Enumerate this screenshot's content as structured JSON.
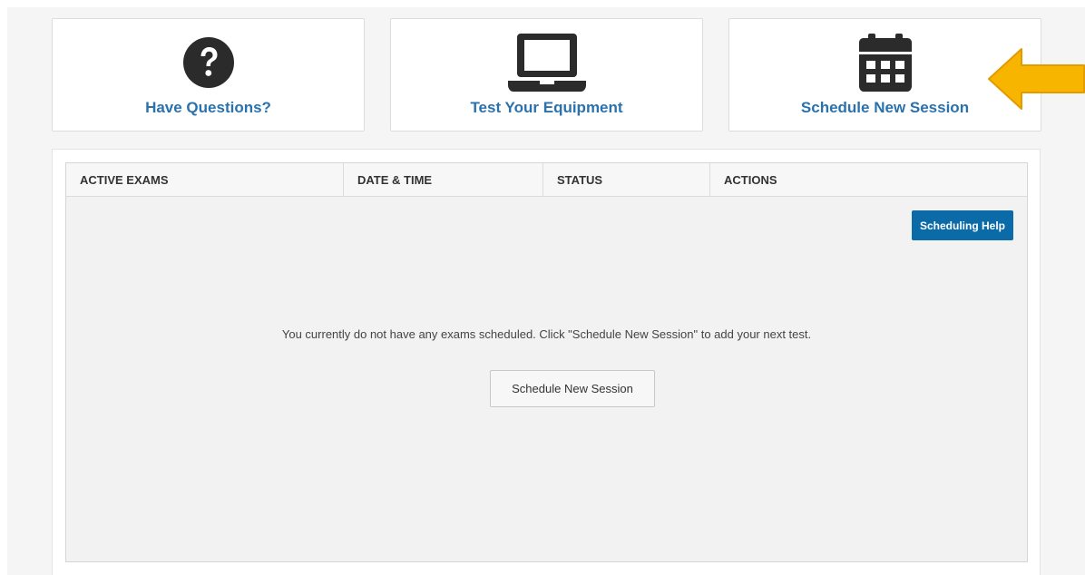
{
  "cards": [
    {
      "label": "Have Questions?",
      "icon": "question-circle-icon"
    },
    {
      "label": "Test Your Equipment",
      "icon": "laptop-icon"
    },
    {
      "label": "Schedule New Session",
      "icon": "calendar-icon"
    }
  ],
  "table": {
    "headers": [
      "ACTIVE EXAMS",
      "DATE & TIME",
      "STATUS",
      "ACTIONS"
    ],
    "help_button": "Scheduling Help",
    "empty_message": "You currently do not have any exams scheduled. Click \"Schedule New Session\" to add your next test.",
    "schedule_button": "Schedule New Session"
  },
  "colors": {
    "link": "#2a72ae",
    "primary_button": "#0b6aa8",
    "arrow": "#f7b500",
    "icon": "#2b2b2b"
  }
}
